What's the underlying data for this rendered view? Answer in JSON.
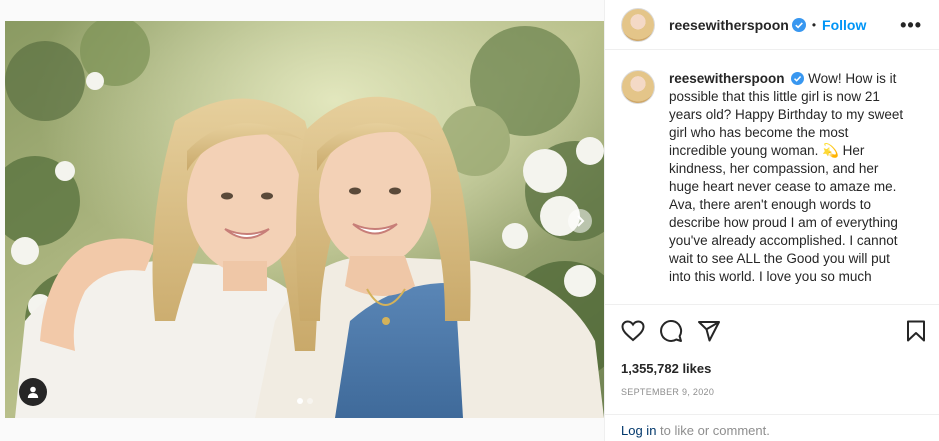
{
  "post": {
    "username": "reesewitherspoon",
    "follow_label": "Follow",
    "separator": "•",
    "more_label": "•••",
    "caption": "Wow! How is it possible that this little girl is now 21 years old? Happy Birthday to my sweet girl who has become the most incredible young woman. 💫 Her kindness, her compassion, and her huge heart never cease to amaze me. Ava, there aren't enough words to describe how proud I am of everything you've already accomplished. I cannot wait to see ALL the Good you will put into this world. I love you so much",
    "likes": "1,355,782 likes",
    "date": "SEPTEMBER 9, 2020"
  },
  "login": {
    "link_label": "Log in",
    "rest": " to like or comment."
  },
  "carousel": {
    "slide_count": 2,
    "active_index": 0
  },
  "icons": {
    "verified": "verified-badge-icon",
    "like": "heart-icon",
    "comment": "comment-icon",
    "share": "paper-plane-icon",
    "save": "bookmark-icon",
    "next": "chevron-right-icon",
    "tag": "user-tag-icon"
  },
  "colors": {
    "accent": "#0095f6",
    "verified": "#3897f0",
    "muted": "#8e8e8e",
    "text": "#262626"
  }
}
